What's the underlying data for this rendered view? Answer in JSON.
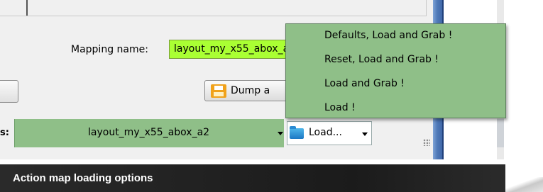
{
  "form": {
    "mapping_label": "Mapping name:",
    "mapping_value": "layout_my_x55_abox_a2"
  },
  "dump_button": {
    "label": "Dump a"
  },
  "status_bar": {
    "label": "s:",
    "combo_value": "layout_my_x55_abox_a2",
    "load_button_label": "Load..."
  },
  "load_menu": {
    "items": [
      "Defaults, Load and Grab !",
      "Reset, Load and Grab !",
      "Load and Grab !",
      "Load !"
    ]
  },
  "caption": {
    "text": "Action map loading options"
  },
  "colors": {
    "highlight_green": "#aaff33",
    "menu_green": "#8fbf88",
    "caption_bg": "#1b1b1b"
  }
}
